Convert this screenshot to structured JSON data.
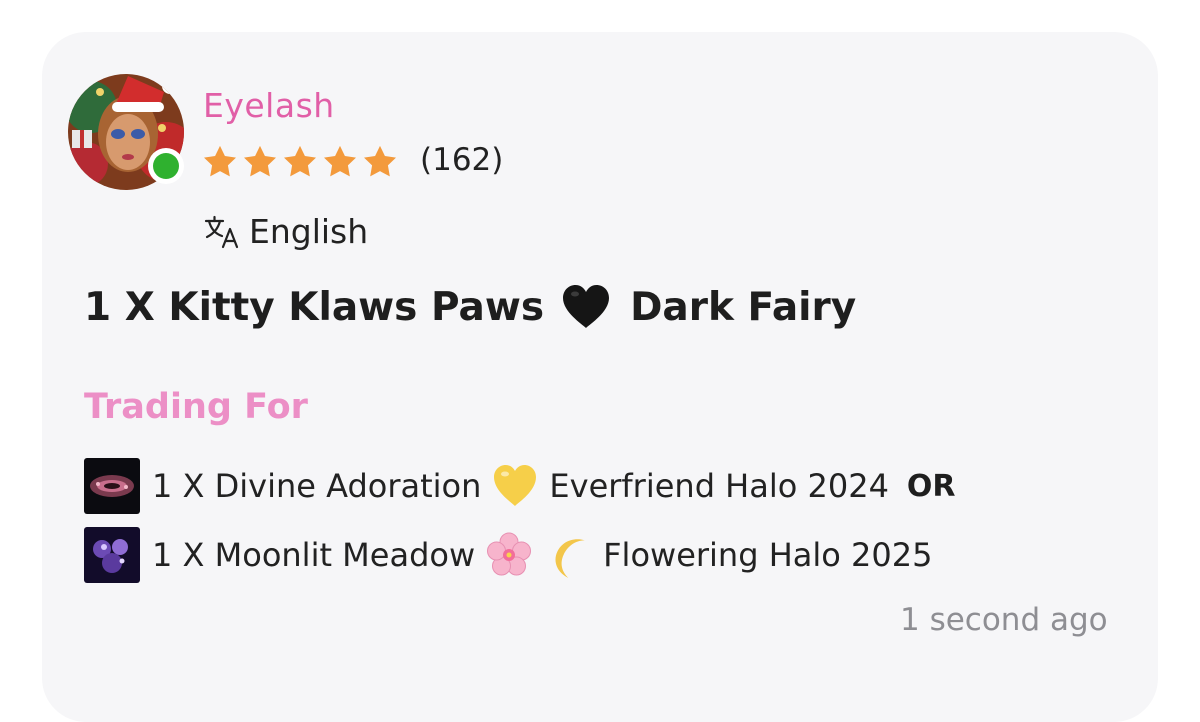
{
  "user": {
    "name": "Eyelash",
    "rating_stars": 5,
    "rating_count": "(162)",
    "online": true
  },
  "language": {
    "label": "English",
    "icon": "translate-icon"
  },
  "listing": {
    "title_part1": "1 X Kitty Klaws Paws",
    "title_emoji": "black-heart-icon",
    "title_part2": "Dark Fairy"
  },
  "trading": {
    "header": "Trading For",
    "items": [
      {
        "text_part1": "1 X Divine Adoration",
        "emoji": "yellow-heart-icon",
        "text_part2": "Everfriend Halo 2024",
        "suffix": "OR"
      },
      {
        "text_part1": "1 X Moonlit Meadow",
        "emoji": "cherry-blossom-icon",
        "emoji2": "crescent-moon-icon",
        "text_part2": "Flowering Halo 2025"
      }
    ]
  },
  "timestamp": "1 second ago",
  "colors": {
    "username": "#e15fa7",
    "trading_header": "#ec8fc6",
    "star": "#f39a3c",
    "online_dot": "#2fb12f",
    "card_bg": "#f6f6f8",
    "timestamp": "#8e8e93"
  }
}
